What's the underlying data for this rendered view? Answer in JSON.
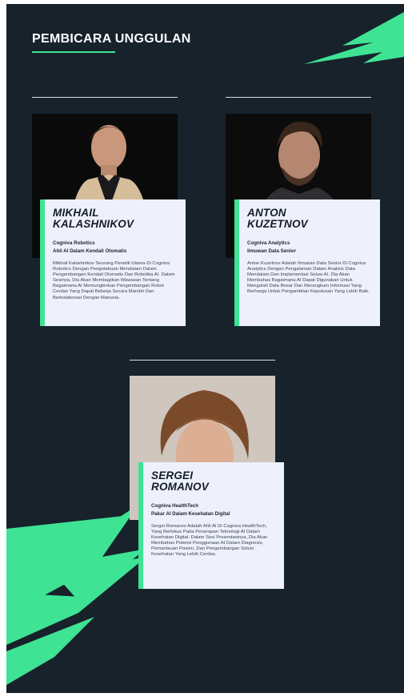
{
  "page": {
    "title": "PEMBICARA UNGGULAN",
    "colors": {
      "background": "#17222b",
      "accent": "#3ee394",
      "card": "#eef1fb"
    }
  },
  "speakers": [
    {
      "name_line1": "MIKHAIL",
      "name_line2": "KALASHNIKOV",
      "company": "Cogniva Robotics",
      "role": "Ahli AI Dalam Kendali Otomatis",
      "bio": "Mikhail Kalashnikov Seorang Peneliti Utama Di Cogniva Robotics Dengan Pengetahuan Mendalam Dalam Pengembangan Kendali Otomatis Dan Robotika AI. Dalam Sesinya, Dia Akan Membagikan Wawasan Tentang Bagaimana AI Memungkinkan Pengembangan Robot Cerdas Yang Dapat Bekerja Secara Mandiri Dan Berkolaborasi Dengan Manusia."
    },
    {
      "name_line1": "ANTON",
      "name_line2": "KUZETNOV",
      "company": "Cogniva Analytics",
      "role": "Ilmuwan Data Senior",
      "bio": "Anton Kuzetnov Adalah Ilmuwan Data Senior Di Cogniva Analytics Dengan Pengalaman Dalam Analisis Data Mendalam Dan Implementasi Solusi AI. Dia Akan Membahas Bagaimana AI Dapat Digunakan Untuk Mengolah Data Besar Dan Merangkum Informasi Yang Berharga Untuk Pengambilan Keputusan Yang Lebih Baik."
    },
    {
      "name_line1": "SERGEI",
      "name_line2": "ROMANOV",
      "company": "Cogniva HealthTech",
      "role": "Pakar AI Dalam Kesehatan Digital",
      "bio": "Sergei Romanov Adalah Ahli AI Di Cogniva HealthTech, Yang Berfokus Pada Penerapan Teknologi AI Dalam Kesehatan Digital. Dalam Sesi Presentasinya, Dia Akan Membahas Potensi Penggunaan AI Dalam Diagnosis, Pemantauan Pasien, Dan Pengembangan Solusi Kesehatan Yang Lebih Cerdas."
    }
  ]
}
